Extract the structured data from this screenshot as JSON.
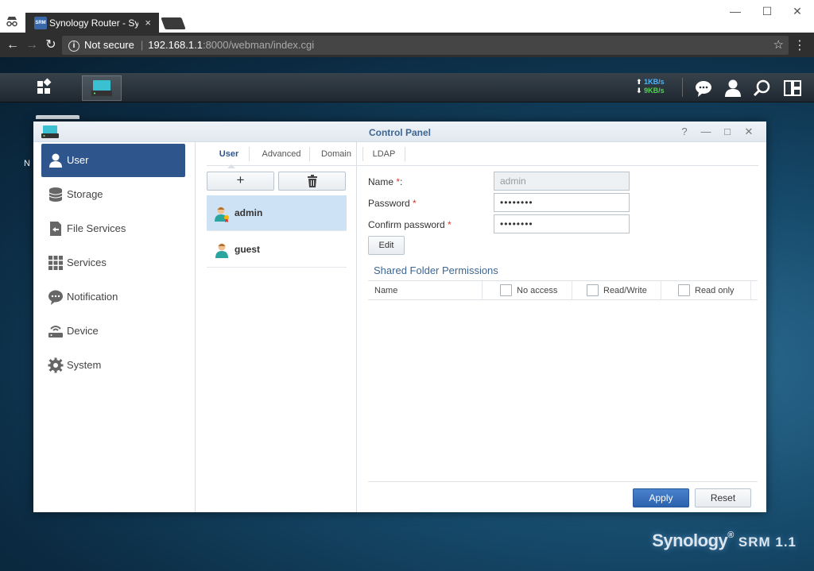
{
  "browser": {
    "tab_title": "Synology Router - Synolo",
    "tab_favicon": "SRM",
    "tab_close": "×",
    "security_label": "Not secure",
    "url_host": "192.168.1.1",
    "url_path": ":8000/webman/index.cgi",
    "minimize": "—",
    "maximize": "☐",
    "close": "✕"
  },
  "taskbar": {
    "upload_speed": "1KB/s",
    "download_speed": "9KB/s"
  },
  "desktop": {
    "peek_text": "N",
    "brand": "Synology",
    "brand_product": "SRM 1.1"
  },
  "window": {
    "title": "Control Panel",
    "help": "?",
    "minimize": "—",
    "maximize": "□",
    "close": "✕"
  },
  "sidebar": {
    "items": [
      {
        "label": "User",
        "icon": "user-icon"
      },
      {
        "label": "Storage",
        "icon": "storage-icon"
      },
      {
        "label": "File Services",
        "icon": "file-services-icon"
      },
      {
        "label": "Services",
        "icon": "services-icon"
      },
      {
        "label": "Notification",
        "icon": "notification-icon"
      },
      {
        "label": "Device",
        "icon": "device-icon"
      },
      {
        "label": "System",
        "icon": "system-icon"
      }
    ]
  },
  "tabs": [
    "User",
    "Advanced",
    "Domain",
    "LDAP"
  ],
  "toolbar": {
    "add": "+",
    "delete": "🗑"
  },
  "users": [
    {
      "name": "admin",
      "selected": true
    },
    {
      "name": "guest",
      "selected": false
    }
  ],
  "form": {
    "name_label": "Name",
    "name_value": "admin",
    "password_label": "Password",
    "password_value": "••••••••",
    "confirm_label": "Confirm password",
    "confirm_value": "••••••••",
    "edit_label": "Edit"
  },
  "permissions": {
    "title": "Shared Folder Permissions",
    "columns": [
      "Name",
      "No access",
      "Read/Write",
      "Read only"
    ]
  },
  "footer": {
    "apply": "Apply",
    "reset": "Reset"
  },
  "colors": {
    "accent": "#2e568d",
    "selected_row": "#cde3f5",
    "apply": "#3a72bf"
  }
}
